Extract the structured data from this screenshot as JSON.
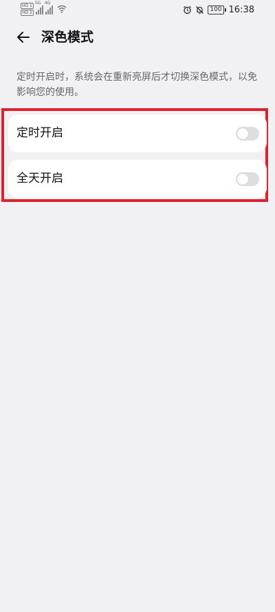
{
  "status_bar": {
    "sim_tags": [
      "HD 1",
      "HD 2"
    ],
    "network_labels": [
      "5G",
      "4G"
    ],
    "battery": "100",
    "time": "16:38",
    "icons": [
      "signal-icon",
      "wifi-icon",
      "alarm-icon",
      "mute-icon",
      "battery-icon"
    ]
  },
  "header": {
    "title": "深色模式",
    "back_icon": "back-arrow-icon"
  },
  "description": "定时开启时，系统会在重新亮屏后才切换深色模式，以免影响您的使用。",
  "options": [
    {
      "label": "定时开启",
      "enabled": false
    },
    {
      "label": "全天开启",
      "enabled": false
    }
  ],
  "colors": {
    "background": "#f1f1f3",
    "card": "#ffffff",
    "highlight_border": "#e2202c",
    "toggle_off": "#dedede"
  }
}
